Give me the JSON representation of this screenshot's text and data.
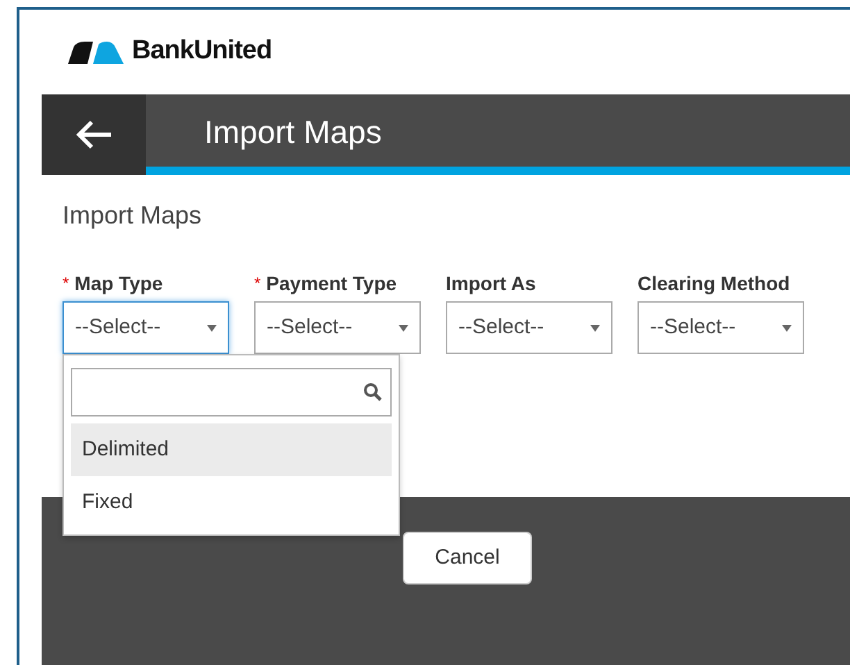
{
  "brand": {
    "name": "BankUnited"
  },
  "header": {
    "title": "Import Maps"
  },
  "page_heading": "Import Maps",
  "fields": [
    {
      "required_mark": "*",
      "label": "Map Type",
      "value": "--Select--",
      "expanded": true
    },
    {
      "required_mark": "*",
      "label": "Payment Type",
      "value": "--Select--",
      "expanded": false
    },
    {
      "label": "Import As",
      "value": "--Select--",
      "expanded": false
    },
    {
      "label": "Clearing Method",
      "value": "--Select--",
      "expanded": false
    }
  ],
  "dropdown": {
    "options": [
      {
        "label": "Delimited",
        "selected": true
      },
      {
        "label": "Fixed",
        "selected": false
      }
    ]
  },
  "buttons": [
    {
      "label": "Cancel"
    }
  ]
}
